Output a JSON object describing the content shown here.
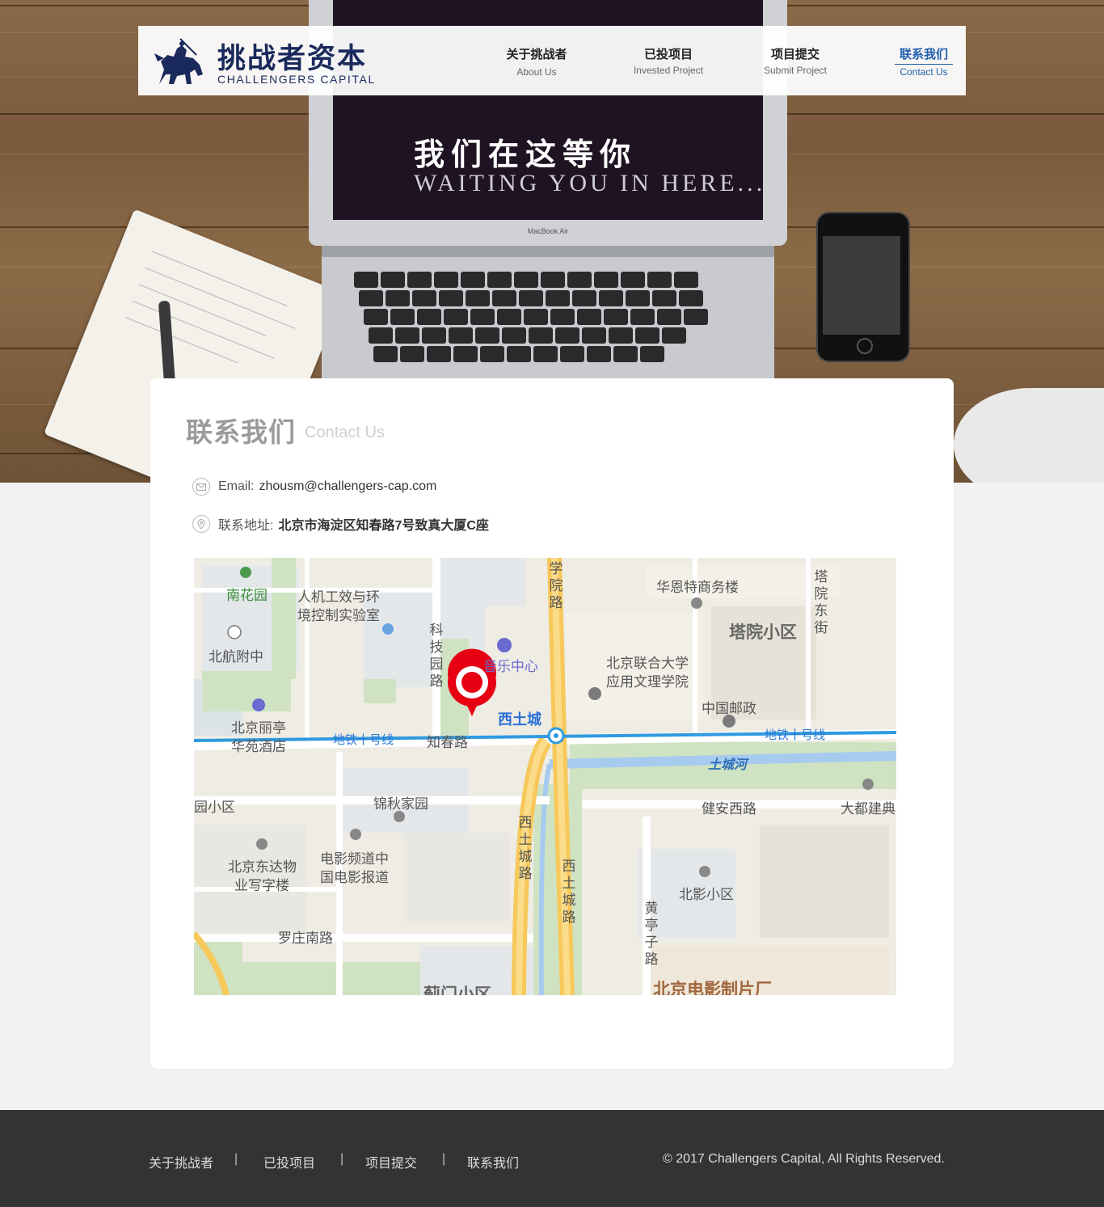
{
  "brand": {
    "name_cn": "挑战者资本",
    "name_en": "CHALLENGERS CAPITAL"
  },
  "nav": [
    {
      "cn": "关于挑战者",
      "en": "About Us",
      "active": false
    },
    {
      "cn": "已投项目",
      "en": "Invested Project",
      "active": false
    },
    {
      "cn": "项目提交",
      "en": "Submit Project",
      "active": false
    },
    {
      "cn": "联系我们",
      "en": "Contact Us",
      "active": true
    }
  ],
  "hero": {
    "title_cn": "我们在这等你",
    "title_en": "WAITING YOU IN HERE...",
    "laptop_brand": "MacBook Air"
  },
  "contact": {
    "title_cn": "联系我们",
    "title_en": "Contact Us",
    "email_label": "Email:",
    "email": "zhousm@challengers-cap.com",
    "address_label": "联系地址:",
    "address": "北京市海淀区知春路7号致真大厦C座"
  },
  "map": {
    "labels": {
      "nanhuayuan": "南花园",
      "renji": "人机工效与环",
      "renji2": "境控制实验室",
      "beihang": "北航附中",
      "keji": "科技园路",
      "xueyuan": "学院路",
      "huaen": "华恩特商务楼",
      "tayuan": "塔院小区",
      "tayuan_st": "塔院东街",
      "yinyue": "音乐中心",
      "lianda": "北京联合大学",
      "lianda2": "应用文理学院",
      "lit": "北京丽亭",
      "lit2": "华苑酒店",
      "youzheng": "中国邮政",
      "xitucheng": "西土城",
      "subway_left": "地铁十号线",
      "zhichun": "知春路",
      "subway_right": "地铁十号线",
      "tucheng_river": "土城河",
      "xiaoqu_left": "园小区",
      "jinqiu": "锦秋家园",
      "jianan": "健安西路",
      "dadu": "大都建典",
      "dongda": "北京东达物",
      "dongda2": "业写字楼",
      "dianying": "电影频道中",
      "dianying2": "国电影报道",
      "xtc_road1": "西土城路",
      "xtc_road2": "西土城路",
      "huangting": "黄亭子路",
      "beiying": "北影小区",
      "luozhuang": "罗庄南路",
      "jimen": "蓟门小区",
      "film_studio": "北京电影制片厂"
    }
  },
  "footer": {
    "links": [
      "关于挑战者",
      "已投项目",
      "项目提交",
      "联系我们"
    ],
    "separator": "|",
    "copyright": "© 2017 Challengers Capital, All Rights Reserved."
  },
  "colors": {
    "brand_navy": "#1b2a5c",
    "accent_blue": "#1f5fb0",
    "footer_bg": "#333333",
    "map_pin": "#e60012"
  }
}
